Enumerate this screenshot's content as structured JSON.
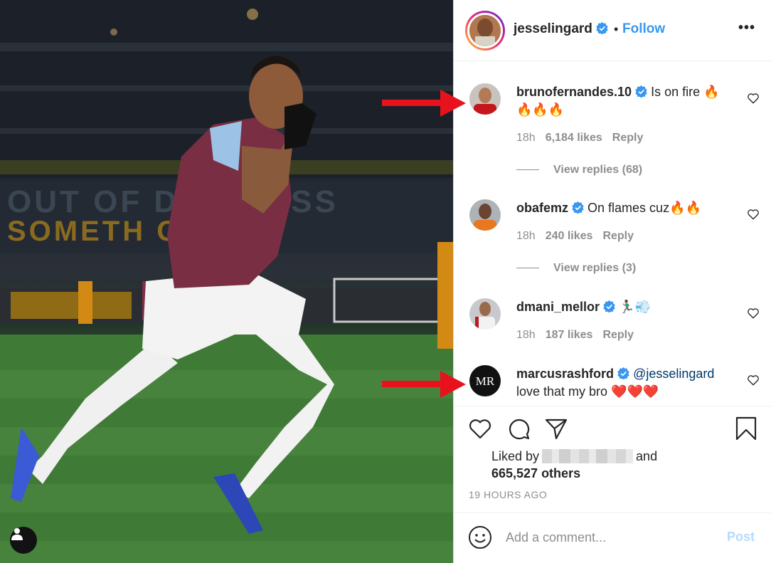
{
  "post": {
    "author": "jesselingard",
    "follow_label": "Follow",
    "separator": "•",
    "more_label": "•••"
  },
  "comments": [
    {
      "username": "brunofernandes.10",
      "text": "Is on fire 🔥🔥🔥🔥",
      "time": "18h",
      "likes": "6,184 likes",
      "reply": "Reply",
      "view_replies": "View replies (68)"
    },
    {
      "username": "obafemz",
      "text": "On flames cuz🔥🔥",
      "time": "18h",
      "likes": "240 likes",
      "reply": "Reply",
      "view_replies": "View replies (3)"
    },
    {
      "username": "dmani_mellor",
      "text": "🏃🏾‍♂️💨",
      "time": "18h",
      "likes": "187 likes",
      "reply": "Reply"
    },
    {
      "username": "marcusrashford",
      "mention": "@jesselingard",
      "text": "love that my bro ❤️❤️❤️"
    }
  ],
  "likes": {
    "prefix": "Liked by",
    "and": "and",
    "count": "665,527 others"
  },
  "timestamp": "19 HOURS AGO",
  "add_comment": {
    "placeholder": "Add a comment...",
    "post_label": "Post"
  },
  "colors": {
    "follow": "#3897f0",
    "verified": "#3897f0",
    "annotation_arrow": "#e8121c",
    "post_disabled": "#b3dbff"
  },
  "icons": [
    "heart-icon",
    "comment-icon",
    "share-icon",
    "bookmark-icon",
    "emoji-icon",
    "verified-badge-icon",
    "user-tag-icon"
  ]
}
